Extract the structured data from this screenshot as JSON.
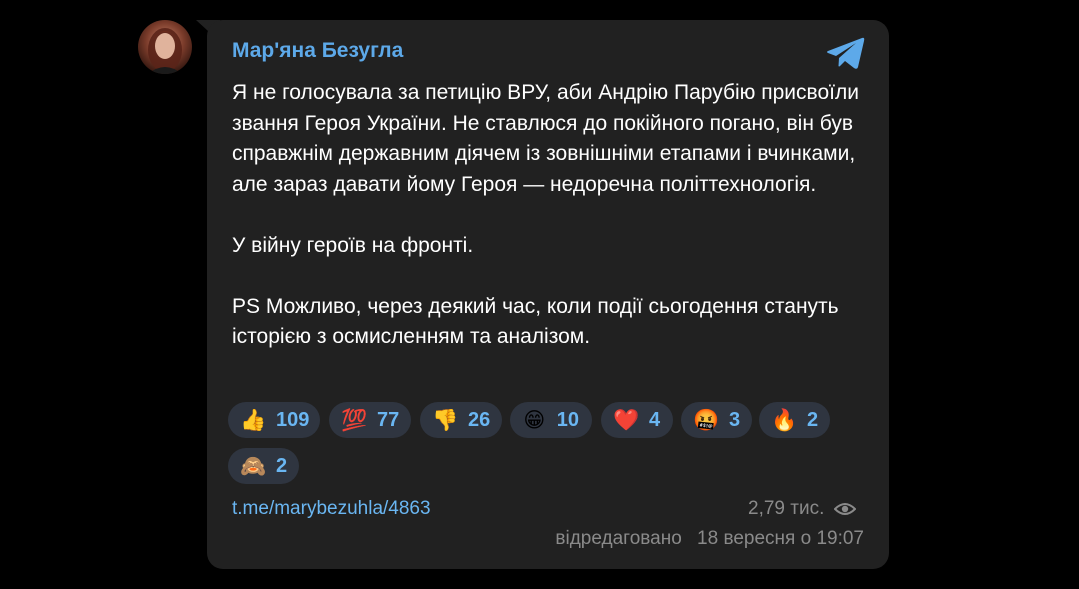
{
  "post": {
    "author": "Мар'яна Безугла",
    "paragraphs": [
      "Я не голосувала за петицію ВРУ, аби Андрію Парубію присвоїли звання Героя України. Не ставлюся до покійного погано, він був справжнім державним діячем із зовнішніми етапами і вчинками, але зараз давати йому Героя — недоречна політтехнологія.",
      "У війну героїв на фронті.",
      "PS Можливо, через деякий час, коли події сьогодення стануть історією з осмисленням та аналізом."
    ],
    "reactions": [
      {
        "emoji": "👍",
        "count": "109"
      },
      {
        "emoji": "💯",
        "count": "77"
      },
      {
        "emoji": "👎",
        "count": "26"
      },
      {
        "emoji": "😁",
        "count": "10"
      },
      {
        "emoji": "❤️",
        "count": "4"
      },
      {
        "emoji": "🤬",
        "count": "3"
      },
      {
        "emoji": "🔥",
        "count": "2"
      },
      {
        "emoji": "🙈",
        "count": "2"
      }
    ],
    "link": "t.me/marybezuhla/4863",
    "views": "2,79 тис.",
    "edited_label": "відредаговано",
    "timestamp": "18 вересня о 19:07"
  },
  "icons": {
    "telegram": "telegram-logo-icon",
    "views": "eye-icon"
  },
  "colors": {
    "background": "#000000",
    "bubble": "#212121",
    "accent": "#5da9e9",
    "reaction_bg": "#2f3540",
    "muted": "#8a8a8a"
  }
}
